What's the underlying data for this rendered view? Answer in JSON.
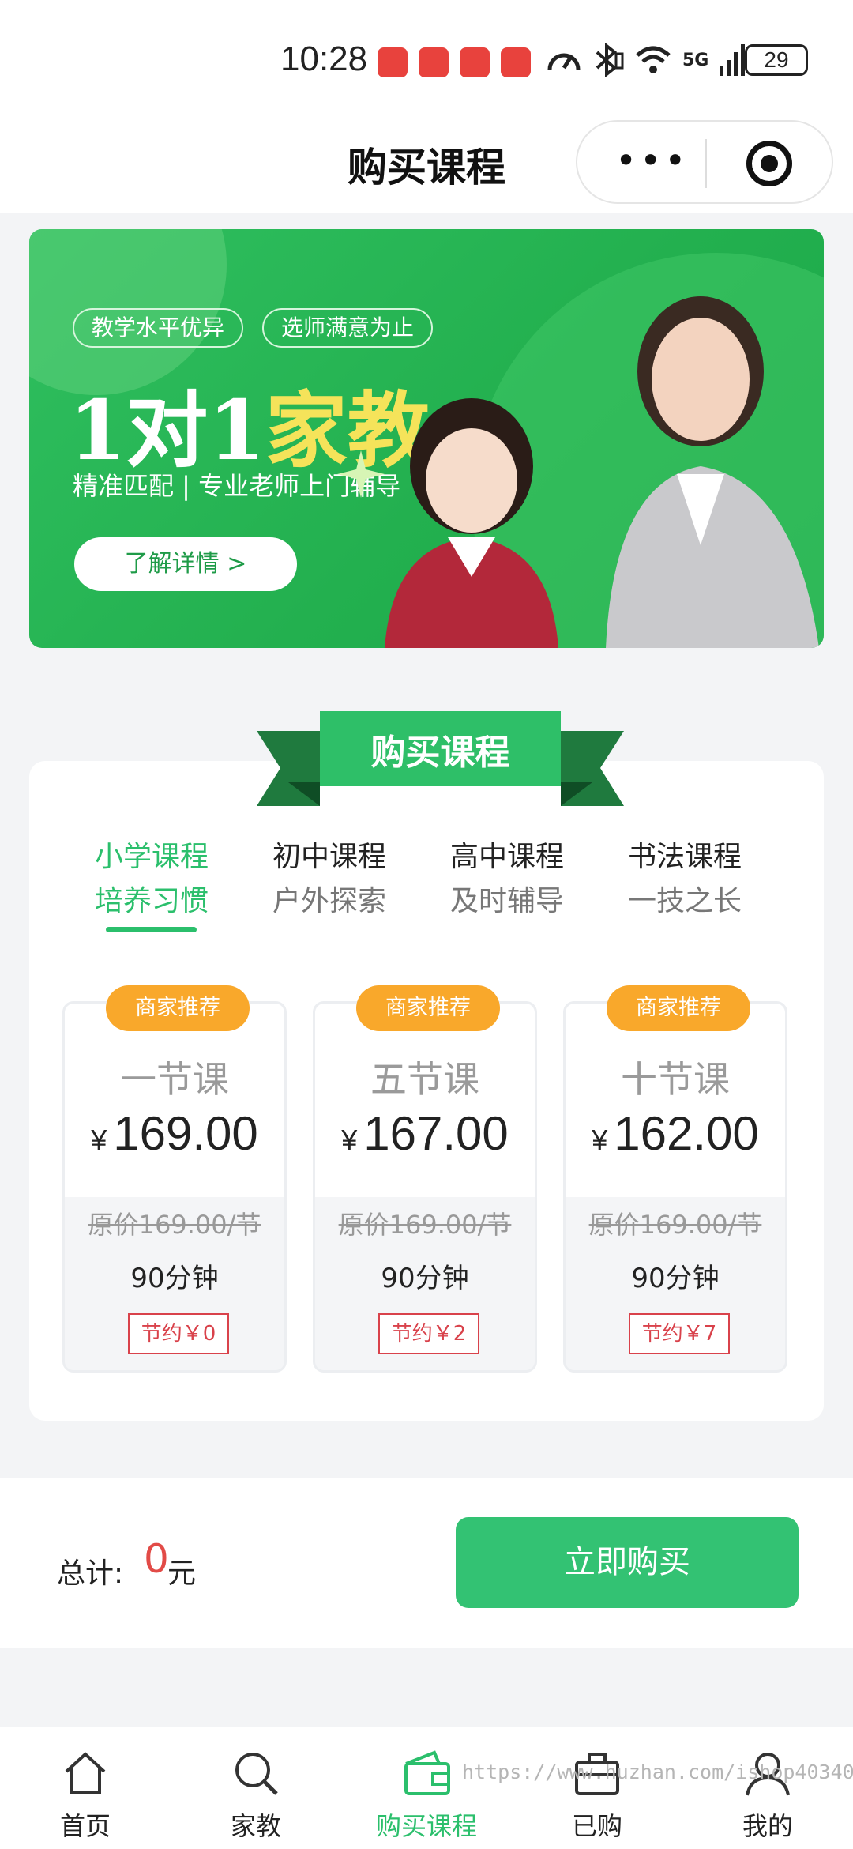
{
  "status_bar": {
    "time": "10:28",
    "network": "5G",
    "battery": "29"
  },
  "nav": {
    "title": "购买课程"
  },
  "banner": {
    "tags": [
      "教学水平优异",
      "选师满意为止"
    ],
    "title_part1": "1对1",
    "title_part2": "家教",
    "subtitle": "精准匹配 | 专业老师上门辅导",
    "button": "了解详情 >"
  },
  "section": {
    "ribbon_title": "购买课程",
    "tabs": [
      {
        "line1": "小学课程",
        "line2": "培养习惯",
        "active": true
      },
      {
        "line1": "初中课程",
        "line2": "户外探索",
        "active": false
      },
      {
        "line1": "高中课程",
        "line2": "及时辅导",
        "active": false
      },
      {
        "line1": "书法课程",
        "line2": "一技之长",
        "active": false
      }
    ],
    "packages": [
      {
        "badge": "商家推荐",
        "name": "一节课",
        "currency": "¥",
        "price": "169.00",
        "original": "原价169.00/节",
        "duration": "90分钟",
        "saving": "节约￥0"
      },
      {
        "badge": "商家推荐",
        "name": "五节课",
        "currency": "¥",
        "price": "167.00",
        "original": "原价169.00/节",
        "duration": "90分钟",
        "saving": "节约￥2"
      },
      {
        "badge": "商家推荐",
        "name": "十节课",
        "currency": "¥",
        "price": "162.00",
        "original": "原价169.00/节",
        "duration": "90分钟",
        "saving": "节约￥7"
      }
    ]
  },
  "purchase": {
    "total_label": "总计:",
    "total_value": "0",
    "total_unit": "元",
    "buy_button": "立即购买"
  },
  "tabbar": {
    "items": [
      {
        "label": "首页",
        "icon": "home-icon"
      },
      {
        "label": "家教",
        "icon": "search-icon"
      },
      {
        "label": "购买课程",
        "icon": "wallet-icon",
        "active": true
      },
      {
        "label": "已购",
        "icon": "briefcase-icon"
      },
      {
        "label": "我的",
        "icon": "user-icon"
      }
    ]
  },
  "watermark": "https://www.huzhan.com/ishop40340",
  "colors": {
    "accent": "#2bbf6c",
    "button": "#33c273",
    "badge": "#f9a82b",
    "saving": "#d9424b"
  }
}
